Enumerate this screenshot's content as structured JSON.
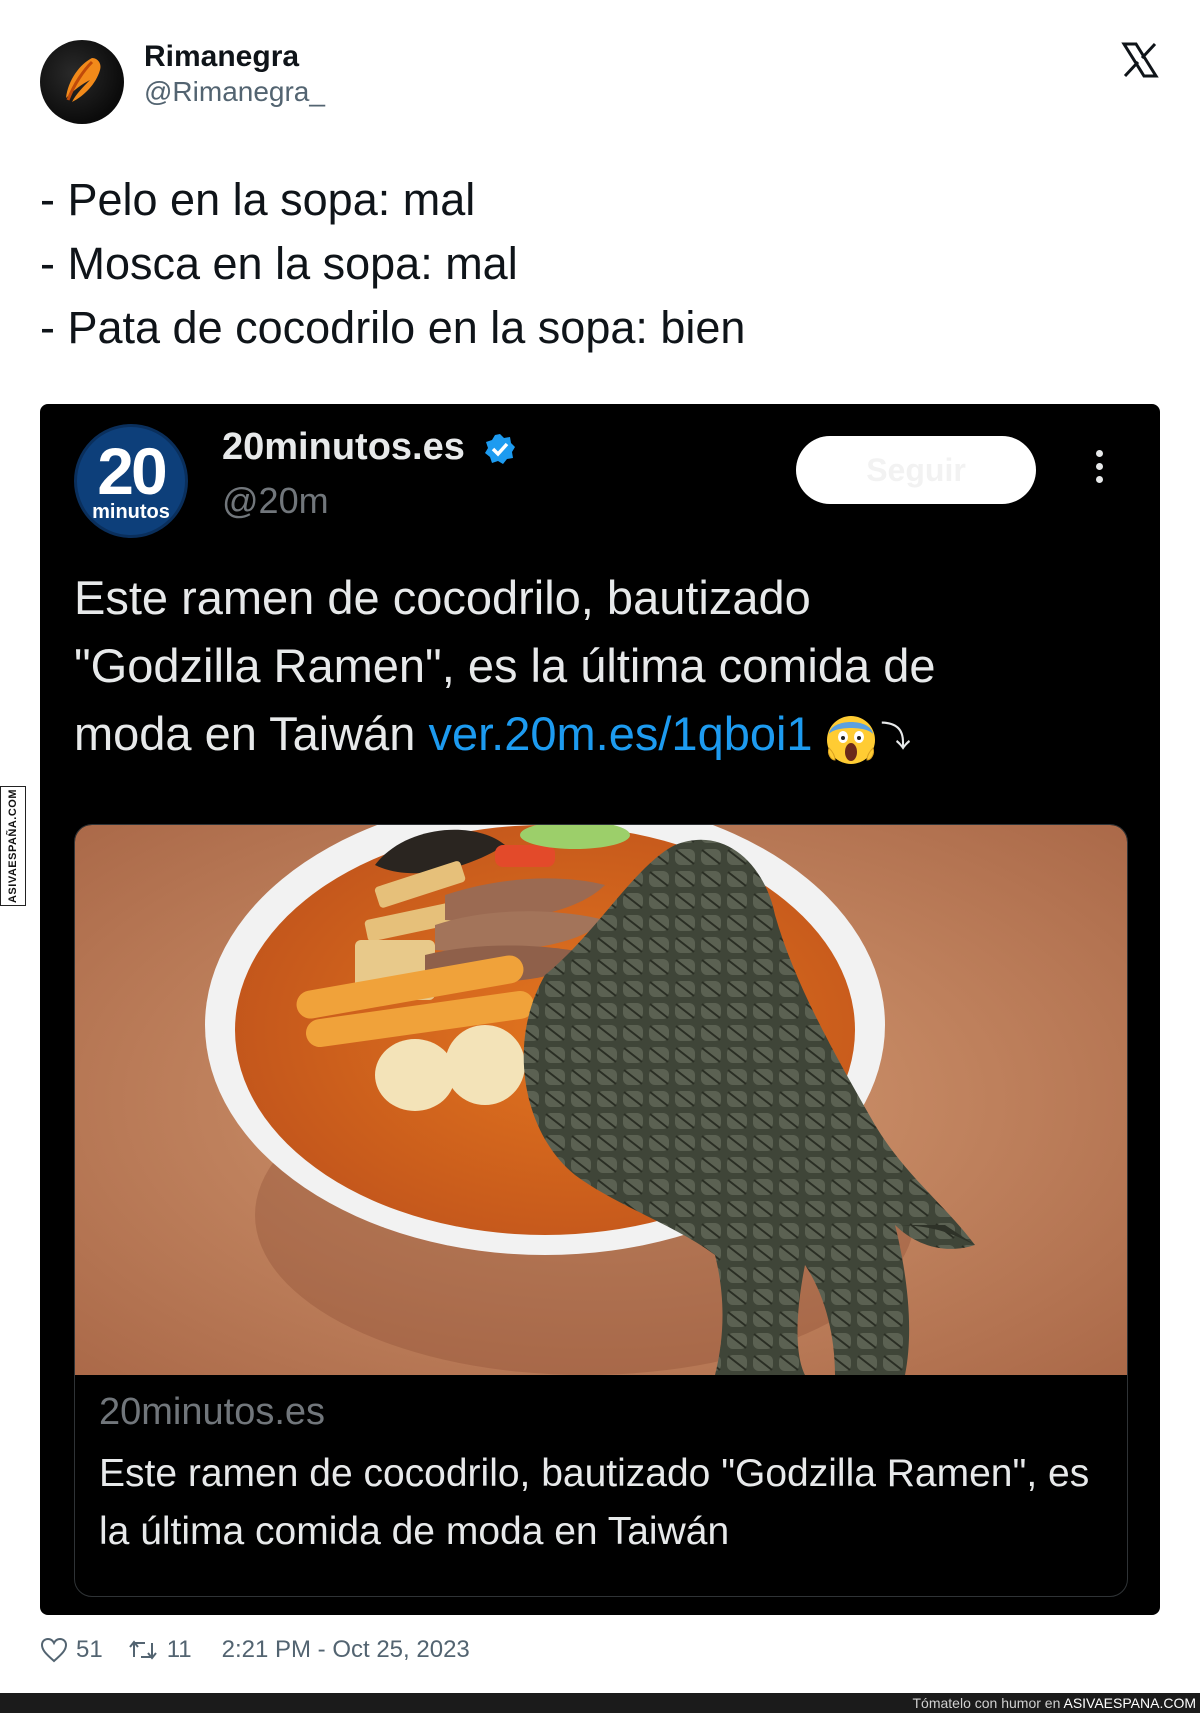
{
  "watermark": {
    "side_text": "ASIVAESPAÑA.COM"
  },
  "author": {
    "name": "Rimanegra",
    "handle": "@Rimanegra_"
  },
  "tweet": {
    "lines": [
      "- Pelo en la sopa: mal",
      "- Mosca en la sopa: mal",
      "- Pata de cocodrilo en la sopa: bien"
    ]
  },
  "quoted": {
    "avatar_number": "20",
    "avatar_word": "minutos",
    "name": "20minutos.es",
    "handle": "@20m",
    "follow_label": "Seguir",
    "text_line1": "Este ramen de cocodrilo, bautizado",
    "text_line2": "\"Godzilla Ramen\", es la última comida de",
    "text_line3": "moda en Taiwán ",
    "link": "ver.20m.es/1qboi1",
    "return_symbol": "⤵",
    "card": {
      "domain": "20minutos.es",
      "title": "Este ramen de cocodrilo, bautizado \"Godzilla Ramen\", es la última comida de moda en Taiwán"
    }
  },
  "stats": {
    "likes": "51",
    "retweets": "11",
    "timestamp": "2:21 PM - Oct 25, 2023"
  },
  "bottom_strip": {
    "text": "Tómatelo con humor en ",
    "site": "ASIVAESPANA.COM"
  },
  "colors": {
    "link": "#1d9bf0",
    "verified": "#1d9bf0",
    "card_bg": "#000000"
  }
}
